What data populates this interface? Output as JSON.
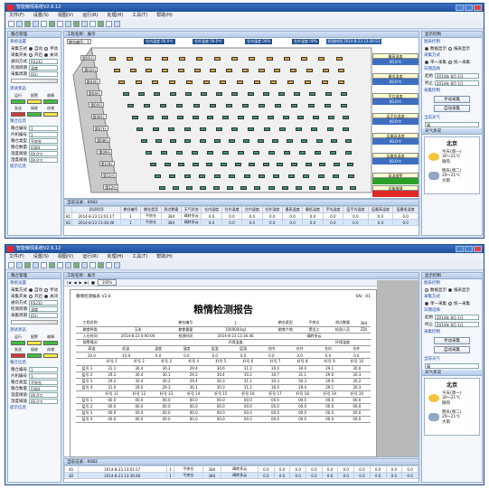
{
  "app": {
    "title": "智能粮情系统V2.6.12",
    "menu": [
      "文件(F)",
      "设置(S)",
      "视图(V)",
      "运行(R)",
      "处理(H)",
      "工具(T)",
      "帮助(H)"
    ]
  },
  "left": {
    "header": "粮仓管理",
    "sys_section": "系统设置",
    "fields": [
      {
        "label": "采集方式",
        "opt1": "自动",
        "opt2": "手动"
      },
      {
        "label": "采集开关",
        "opt1": "开启",
        "opt2": "关闭"
      },
      {
        "label": "通讯方式",
        "value": "RS232"
      },
      {
        "label": "检测周期",
        "value": "温度"
      },
      {
        "label": "采集周期",
        "value": "01h"
      }
    ],
    "status_section": "测试状态",
    "indicators": [
      {
        "label": "运行",
        "color": "#3fbf3f"
      },
      {
        "label": "报警",
        "color": "#f1e84a"
      },
      {
        "label": "故障",
        "color": "#3fbf3f"
      },
      {
        "label": "发送",
        "color": "#d43a3a"
      },
      {
        "label": "接收",
        "color": "#3fbf3f"
      },
      {
        "label": "存储",
        "color": "#f1e84a"
      }
    ],
    "info_section": "粮仓信息",
    "info": [
      {
        "label": "粮仓编号",
        "value": "1"
      },
      {
        "label": "片机编号",
        "value": "1"
      },
      {
        "label": "粮仓类型",
        "value": "平房仓"
      },
      {
        "label": "粮仓数量",
        "value": "0384"
      },
      {
        "label": "温度阈值",
        "value": "00.0℃"
      },
      {
        "label": "湿度阈值",
        "value": "00.0℃"
      }
    ],
    "hint": "提示信息"
  },
  "w1": {
    "center_header": "工程名称：展示",
    "granary_label": "粮仓编号：1",
    "temps": [
      "仓内温度 00.0℃",
      "仓外温度 00.0℃",
      "仓内湿度 00%",
      "仓外湿度 00%",
      "检测时间  2014-8-23 13:36:53",
      "粮仓：1"
    ],
    "layers": [
      "第01行",
      "第02行",
      "第03行",
      "第04行",
      "第05行",
      "第06行",
      "第07行",
      "第08行",
      "第09行",
      "第10行",
      "第11行",
      "第12行"
    ],
    "right_stats": [
      {
        "h": "最高温度",
        "v": "00.0℃"
      },
      {
        "h": "最低温度",
        "v": "00.0℃"
      },
      {
        "h": "平均温度",
        "v": "00.0℃"
      },
      {
        "h": "层平均温度",
        "v": "00.0℃"
      },
      {
        "h": "层最高温度",
        "v": "00.0℃"
      },
      {
        "h": "层最低温度",
        "v": "00.0℃"
      }
    ],
    "warn": [
      {
        "h": "高温报警",
        "c": "#2aa02a"
      },
      {
        "h": "设备故障",
        "c": "#e12828"
      }
    ],
    "log_header": "当前记录：0082",
    "columns": [
      "",
      "测试时间",
      "粮仓编号",
      "粮仓类型",
      "测点数量",
      "天气状态",
      "仓内温度",
      "仓外温度",
      "仓内湿度",
      "仓外湿度",
      "最高温度",
      "最低温度",
      "平均温度",
      "层平均温度",
      "层最高温度",
      "层最低温度"
    ],
    "rows": [
      [
        "81",
        "2014-8-23 13:01:17",
        "1",
        "平房仓",
        "384",
        "晴转多云",
        "0.0",
        "0.0",
        "0.0",
        "0.0",
        "0.0",
        "0.0",
        "0.0",
        "0.0",
        "0.0",
        "0.0"
      ],
      [
        "82",
        "2014-8-23 13:36:46",
        "1",
        "平房仓",
        "384",
        "晴转多云",
        "0.0",
        "0.0",
        "0.0",
        "0.0",
        "0.0",
        "0.0",
        "0.0",
        "0.0",
        "0.0",
        "0.0"
      ]
    ]
  },
  "right": {
    "header": "显示控制",
    "subhdr": "图表控制",
    "show": [
      "数据显示",
      "报表显示"
    ],
    "collect_mode": "采集方式",
    "modes": [
      "单一采集",
      "统一采集"
    ],
    "date_section": "日期选择",
    "from_label": "起始",
    "from": "2014年 8月 1日",
    "to_label": "终止",
    "to": "2014年 8月 1日",
    "control_section": "采集控制",
    "manual": "手动采集",
    "auto": "自动采集",
    "weather_section": "当前天气",
    "weather_select": "晴",
    "weather_hdr": "天气状况",
    "city": "北京",
    "today": "今天(周一)",
    "today_temp": "30~21℃",
    "today_wind": "微风",
    "tomorrow": "明天(周二)",
    "tomorrow_temp": "29~21℃",
    "tomorrow_wind": "大雨"
  },
  "w2": {
    "center_header": "工程名称：展示",
    "zoom": "100%",
    "report_head": "粮情检测报表",
    "version": "V2.6",
    "sn": "SN：01",
    "report_title": "粮情检测报告",
    "meta": [
      [
        "工程名称",
        "",
        "粮仓编号",
        "1",
        "粮仓类型",
        "平房仓",
        "测点数量",
        "384"
      ],
      [
        "粮食种类",
        "玉米",
        "粮食重量",
        "100000(kg)",
        "粮食产地",
        "黑龙江",
        "检测人员",
        "ZDI"
      ],
      [
        "入仓时间",
        "2014-8-23 0:00:00",
        "检测时间",
        "2014-8-23 13:36:46",
        "",
        "晴转多云",
        "",
        ""
      ]
    ],
    "sub": [
      "报警情况",
      "",
      "",
      "环境温度",
      "",
      "",
      "环境湿度",
      ""
    ],
    "hdr1": [
      "高温",
      "低温",
      "温度",
      "湿度",
      "层温",
      "层湿",
      "仓内",
      "仓外",
      "仓内",
      "仓外"
    ],
    "v1": [
      "20.0",
      "-10.0",
      "0.0",
      "0.0",
      "0.0",
      "0.0",
      "0.0",
      "0.0",
      "0.0",
      "0.0"
    ],
    "hdr2": [
      "",
      "杆号 1",
      "杆号 2",
      "杆号 3",
      "杆号 4",
      "杆号 5",
      "杆号 6",
      "杆号 7",
      "杆号 8",
      "杆号 9",
      "杆号 10"
    ],
    "grid": [
      [
        "层号 1",
        "31.1",
        "30.4",
        "30.2",
        "29.4",
        "30.6",
        "31.2",
        "30.4",
        "30.0",
        "29.1",
        "30.0"
      ],
      [
        "层号 2",
        "29.2",
        "30.4",
        "30.1",
        "29.2",
        "30.4",
        "30.2",
        "30.7",
        "31.1",
        "29.0",
        "30.3"
      ],
      [
        "层号 3",
        "29.2",
        "30.4",
        "30.2",
        "29.4",
        "30.3",
        "31.1",
        "30.3",
        "30.3",
        "29.0",
        "30.2"
      ],
      [
        "层号 4",
        "31.0",
        "29.0",
        "29.3",
        "30.1",
        "30.3",
        "31.2",
        "30.0",
        "29.4",
        "29.1",
        "30.3"
      ]
    ],
    "hdr3": [
      "",
      "杆号 11",
      "杆号 12",
      "杆号 13",
      "杆号 14",
      "杆号 15",
      "杆号 16",
      "杆号 17",
      "杆号 18",
      "杆号 19",
      "杆号 20"
    ],
    "grid2": [
      [
        "层号 1",
        "00.0",
        "00.0",
        "00.0",
        "00.0",
        "00.0",
        "00.0",
        "00.0",
        "00.0",
        "00.0",
        "00.0"
      ],
      [
        "层号 2",
        "00.0",
        "00.0",
        "00.0",
        "00.0",
        "00.0",
        "00.0",
        "00.0",
        "00.0",
        "00.0",
        "00.0"
      ],
      [
        "层号 3",
        "00.0",
        "00.0",
        "00.0",
        "00.0",
        "00.0",
        "00.0",
        "00.0",
        "00.0",
        "00.0",
        "00.0"
      ],
      [
        "层号 4",
        "00.0",
        "00.0",
        "00.0",
        "00.0",
        "00.0",
        "00.0",
        "00.0",
        "00.0",
        "00.0",
        "00.0"
      ]
    ],
    "log_header": "当前记录：0082",
    "rows": [
      [
        "81",
        "2014-8-23 13:01:17",
        "1",
        "平房仓",
        "384",
        "晴转多云",
        "0.0",
        "0.0",
        "0.0",
        "0.0",
        "0.0",
        "0.0",
        "0.0",
        "0.0",
        "0.0",
        "0.0"
      ],
      [
        "82",
        "2014-8-23 13:36:46",
        "1",
        "平房仓",
        "384",
        "晴转多云",
        "0.0",
        "0.0",
        "0.0",
        "0.0",
        "0.0",
        "0.0",
        "0.0",
        "0.0",
        "0.0",
        "0.0"
      ]
    ]
  }
}
